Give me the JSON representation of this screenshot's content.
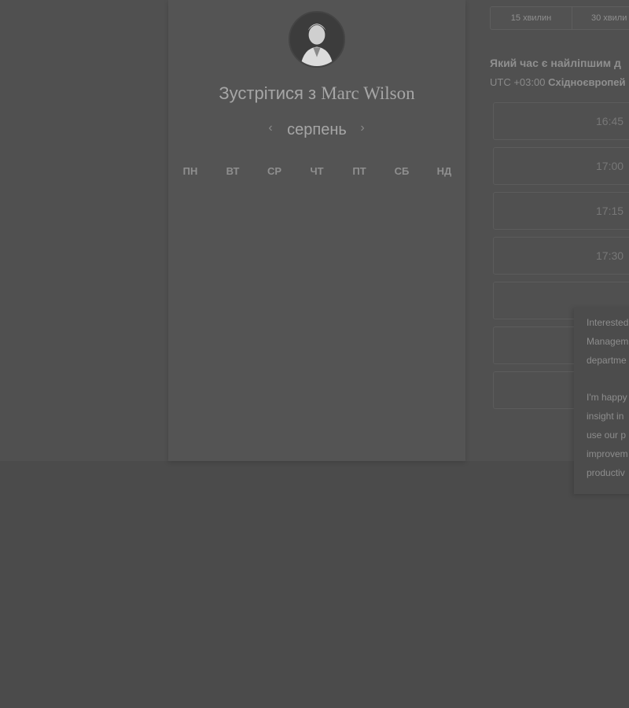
{
  "host": {
    "title_prefix": "Зустрітися з",
    "name": "Marc Wilson"
  },
  "calendar": {
    "month": "серпень",
    "prev_icon": "chevron-left-icon",
    "next_icon": "chevron-right-icon",
    "weekdays": [
      "ПН",
      "ВТ",
      "СР",
      "ЧТ",
      "ПТ",
      "СБ",
      "НД"
    ]
  },
  "durations": {
    "tabs": [
      "15 хвилин",
      "30 хвили"
    ]
  },
  "schedule": {
    "question": "Який час є найліпшим д",
    "tz_offset": "UTC +03:00",
    "tz_name": "Східноєвропей",
    "slots": [
      "16:45",
      "17:00",
      "17:15",
      "17:30",
      "",
      "",
      ""
    ]
  },
  "popup": {
    "lines": [
      "Interested",
      "Managem",
      "departme",
      "",
      "I'm happy",
      "insight in",
      "use our p",
      "improvem",
      "productiv"
    ]
  },
  "colors": {
    "overlay_page": "#4b4b4b",
    "card": "#545454",
    "text_muted": "#a6a6a6"
  }
}
